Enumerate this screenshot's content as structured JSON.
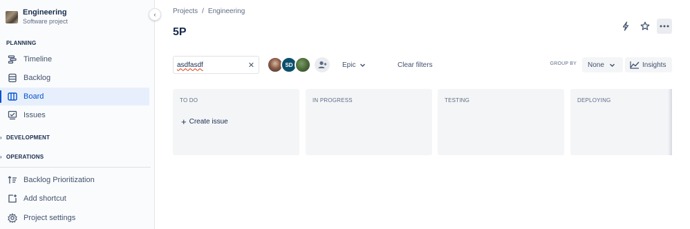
{
  "sidebar": {
    "project": {
      "name": "Engineering",
      "type": "Software project",
      "avatar_icon": "project-avatar"
    },
    "collapse_icon": "chevron-left-icon",
    "sections": {
      "planning": "PLANNING",
      "development": "DEVELOPMENT",
      "operations": "OPERATIONS"
    },
    "planning_items": [
      {
        "label": "Timeline",
        "icon": "timeline-icon"
      },
      {
        "label": "Backlog",
        "icon": "backlog-icon"
      },
      {
        "label": "Board",
        "icon": "board-icon",
        "active": true
      },
      {
        "label": "Issues",
        "icon": "issues-icon"
      }
    ],
    "footer_items": [
      {
        "label": "Backlog Prioritization",
        "icon": "sort-icon"
      },
      {
        "label": "Add shortcut",
        "icon": "add-shortcut-icon"
      },
      {
        "label": "Project settings",
        "icon": "gear-icon"
      }
    ]
  },
  "breadcrumb": {
    "items": [
      "Projects",
      "Engineering"
    ],
    "separator": "/"
  },
  "page": {
    "title": "5P"
  },
  "filters": {
    "search_value": "asdfasdf",
    "epic_label": "Epic",
    "clear_label": "Clear filters",
    "group_by_label": "GROUP BY",
    "group_by_value": "None",
    "insights_label": "Insights",
    "avatar2_initials": "SD"
  },
  "board": {
    "columns": [
      {
        "name": "TO DO",
        "create_label": "Create issue"
      },
      {
        "name": "IN PROGRESS"
      },
      {
        "name": "TESTING"
      },
      {
        "name": "DEPLOYING"
      }
    ]
  },
  "colors": {
    "accent": "#0052cc",
    "active_bg": "#e8effc",
    "column_bg": "#f4f5f7"
  }
}
